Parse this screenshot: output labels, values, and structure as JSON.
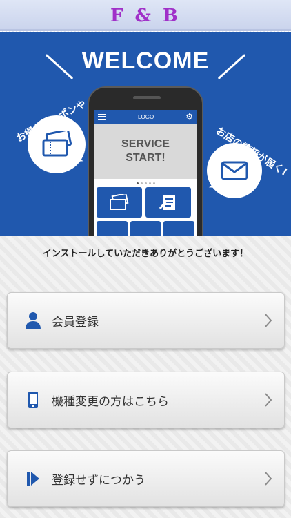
{
  "header": {
    "title": "F & B"
  },
  "banner": {
    "welcome": "WELCOME",
    "coupon_text": "お得なクーポンや",
    "info_text": "お店の情報が届く!",
    "phone": {
      "logo": "LOGO",
      "hero_line1": "SERVICE",
      "hero_line2": "START!"
    }
  },
  "thanks_text": "インストールしていただきありがとうございます！",
  "menu": [
    {
      "label": "会員登録",
      "icon": "user-icon"
    },
    {
      "label": "機種変更の方はこちら",
      "icon": "smartphone-icon"
    },
    {
      "label": "登録せずにつかう",
      "icon": "skip-icon"
    }
  ],
  "colors": {
    "brand": "#2058ae",
    "title": "#a030c8"
  }
}
